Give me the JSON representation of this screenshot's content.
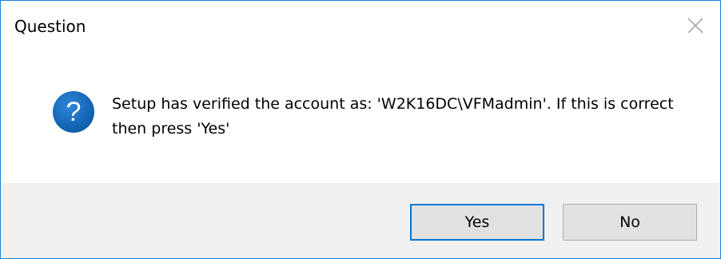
{
  "window": {
    "title": "Question",
    "close_icon": "close-icon",
    "accent_color": "#1883d7"
  },
  "content": {
    "icon": "question-icon",
    "icon_color": "#1064b8",
    "message": "Setup has verified the account as: 'W2K16DC\\VFMadmin'. If this is correct then press 'Yes'"
  },
  "buttons": {
    "yes_label": "Yes",
    "no_label": "No"
  }
}
